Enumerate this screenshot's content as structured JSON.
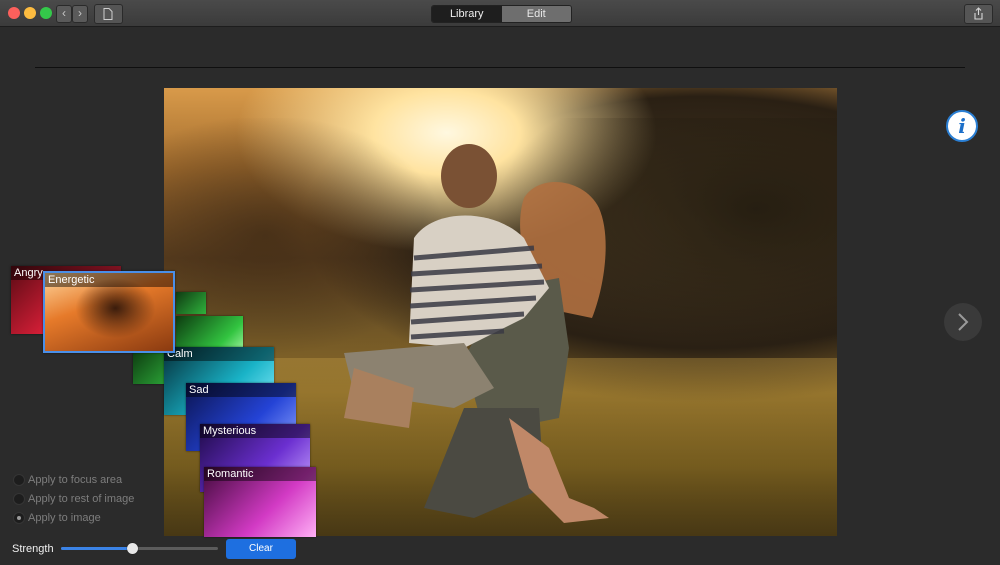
{
  "toolbar": {
    "back_glyph": "‹",
    "forward_glyph": "›",
    "tabs": [
      {
        "label": "Library",
        "active": true
      },
      {
        "label": "Edit",
        "active": false
      }
    ]
  },
  "icons": {
    "info": "i",
    "next": "chevron-right-icon",
    "share": "share-icon",
    "document": "document-icon"
  },
  "moods": [
    {
      "label": "Angry",
      "color": "#e0203a"
    },
    {
      "label": "Energetic",
      "color": "#e67a2a",
      "selected": true
    },
    {
      "label": "",
      "color": "#2fb23c"
    },
    {
      "label": "Calm",
      "color": "#19b3c7"
    },
    {
      "label": "Sad",
      "color": "#2443d6"
    },
    {
      "label": "Mysterious",
      "color": "#6b2fd0"
    },
    {
      "label": "Romantic",
      "color": "#d23ac4"
    }
  ],
  "apply_options": [
    {
      "label": "Apply to focus area",
      "selected": false
    },
    {
      "label": "Apply to rest of image",
      "selected": false
    },
    {
      "label": "Apply to image",
      "selected": true
    }
  ],
  "strength": {
    "label": "Strength",
    "value": 0.45
  },
  "clear_label": "Clear",
  "colors": {
    "accent": "#1e6fe0"
  }
}
